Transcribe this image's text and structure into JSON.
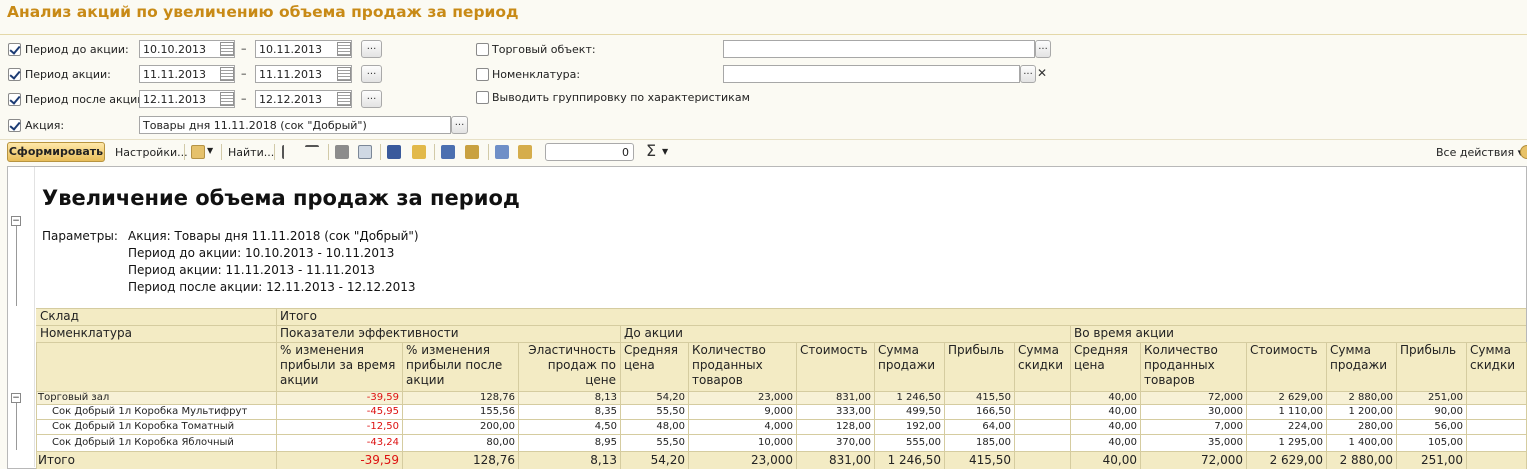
{
  "title": "Анализ акций по увеличению объема продаж за период",
  "filters": {
    "period_before": {
      "label": "Период до акции:",
      "from": "10.10.2013",
      "to": "10.11.2013"
    },
    "period_action": {
      "label": "Период акции:",
      "from": "11.11.2013",
      "to": "11.11.2013"
    },
    "period_after": {
      "label": "Период после акции:",
      "from": "12.11.2013",
      "to": "12.12.2013"
    },
    "action": {
      "label": "Акция:",
      "value": "Товары дня 11.11.2018 (сок \"Добрый\")"
    },
    "trade_object": {
      "label": "Торговый объект:",
      "value": ""
    },
    "nomenclature": {
      "label": "Номенклатура:",
      "value": ""
    },
    "group_chars": {
      "label": "Выводить группировку по характеристикам"
    },
    "dash": "–",
    "dots": "...",
    "clear": "✕"
  },
  "toolbar": {
    "generate": "Сформировать",
    "settings": "Настройки...",
    "find": "Найти...",
    "counter": "0",
    "sigma": "Σ",
    "all_actions": "Все действия"
  },
  "report": {
    "title": "Увеличение объема продаж за период",
    "params_label": "Параметры:",
    "params": [
      "Акция: Товары дня 11.11.2018 (сок \"Добрый\")",
      "Период до акции: 10.10.2013 - 10.11.2013",
      "Период акции: 11.11.2013 - 11.11.2013",
      "Период после акции: 12.11.2013 - 12.12.2013"
    ],
    "hdr_sklad": "Склад",
    "hdr_nom": "Номенклатура",
    "hdr_itogo": "Итого",
    "grp_eff": "Показатели эффективности",
    "grp_before": "До акции",
    "grp_during": "Во время акции",
    "columns": [
      "% изменения прибыли за время акции",
      "% изменения прибыли после акции",
      "Эластичность продаж по цене",
      "Средняя цена",
      "Количество проданных товаров",
      "Стоимость",
      "Сумма продажи",
      "Прибыль",
      "Сумма скидки",
      "Средняя цена",
      "Количество проданных товаров",
      "Стоимость",
      "Сумма продажи",
      "Прибыль",
      "Сумма скидки"
    ],
    "rows": [
      {
        "name": "Торговый зал",
        "values": [
          "-39,59",
          "128,76",
          "8,13",
          "54,20",
          "23,000",
          "831,00",
          "1 246,50",
          "415,50",
          "",
          "40,00",
          "72,000",
          "2 629,00",
          "2 880,00",
          "251,00",
          ""
        ]
      },
      {
        "name": "Сок Добрый 1л Коробка Мультифрут",
        "values": [
          "-45,95",
          "155,56",
          "8,35",
          "55,50",
          "9,000",
          "333,00",
          "499,50",
          "166,50",
          "",
          "40,00",
          "30,000",
          "1 110,00",
          "1 200,00",
          "90,00",
          ""
        ]
      },
      {
        "name": "Сок Добрый 1л Коробка Томатный",
        "values": [
          "-12,50",
          "200,00",
          "4,50",
          "48,00",
          "4,000",
          "128,00",
          "192,00",
          "64,00",
          "",
          "40,00",
          "7,000",
          "224,00",
          "280,00",
          "56,00",
          ""
        ]
      },
      {
        "name": "Сок Добрый 1л Коробка Яблочный",
        "values": [
          "-43,24",
          "80,00",
          "8,95",
          "55,50",
          "10,000",
          "370,00",
          "555,00",
          "185,00",
          "",
          "40,00",
          "35,000",
          "1 295,00",
          "1 400,00",
          "105,00",
          ""
        ]
      },
      {
        "name": "Итого",
        "values": [
          "-39,59",
          "128,76",
          "8,13",
          "54,20",
          "23,000",
          "831,00",
          "1 246,50",
          "415,50",
          "",
          "40,00",
          "72,000",
          "2 629,00",
          "2 880,00",
          "251,00",
          ""
        ]
      }
    ]
  },
  "colors": {
    "title": "#c88a16",
    "header_bg": "#f3ebc4",
    "group_bg": "#f7f1d6",
    "negative": "#dd1111"
  }
}
